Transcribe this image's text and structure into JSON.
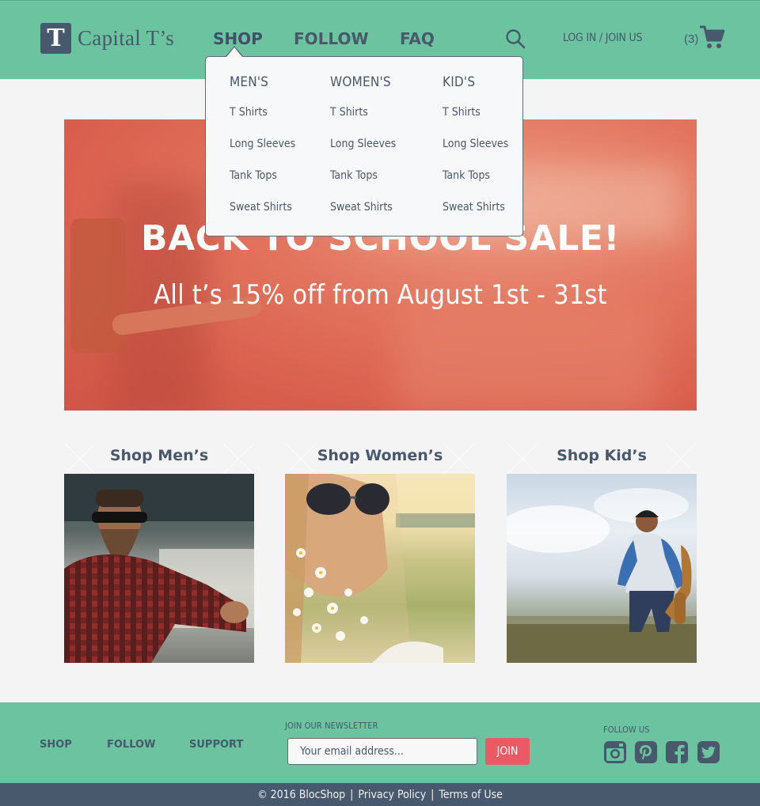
{
  "brand": {
    "logo_letter": "T",
    "name": "Capital T’s"
  },
  "nav": {
    "shop": "SHOP",
    "follow": "FOLLOW",
    "faq": "FAQ"
  },
  "header": {
    "login": "LOG IN / JOIN US",
    "cart_count": "(3)"
  },
  "dropdown": {
    "columns": [
      {
        "heading": "MEN'S",
        "links": [
          "T Shirts",
          "Long Sleeves",
          "Tank Tops",
          "Sweat Shirts"
        ]
      },
      {
        "heading": "WOMEN'S",
        "links": [
          "T Shirts",
          "Long Sleeves",
          "Tank Tops",
          "Sweat Shirts"
        ]
      },
      {
        "heading": "KID'S",
        "links": [
          "T Shirts",
          "Long Sleeves",
          "Tank Tops",
          "Sweat Shirts"
        ]
      }
    ]
  },
  "hero": {
    "title": "BACK TO SCHOOL SALE!",
    "subtitle": "All t’s 15% off from August 1st - 31st"
  },
  "categories": [
    {
      "title": "Shop Men’s"
    },
    {
      "title": "Shop Women’s"
    },
    {
      "title": "Shop Kid’s"
    }
  ],
  "footer": {
    "links": {
      "shop": "SHOP",
      "follow": "FOLLOW",
      "support": "SUPPORT"
    },
    "newsletter_label": "JOIN OUR NEWSLETTER",
    "email_placeholder": "Your email address...",
    "join_label": "JOIN",
    "follow_label": "FOLLOW US",
    "social_icons": [
      "instagram-icon",
      "pinterest-icon",
      "facebook-icon",
      "twitter-icon"
    ]
  },
  "bottom": {
    "copyright": "© 2016 BlocShop",
    "privacy": "Privacy Policy",
    "terms": "Terms of Use",
    "separator": "|"
  },
  "colors": {
    "green": "#6cc3a0",
    "slate": "#48586d",
    "join": "#eb5a64"
  }
}
